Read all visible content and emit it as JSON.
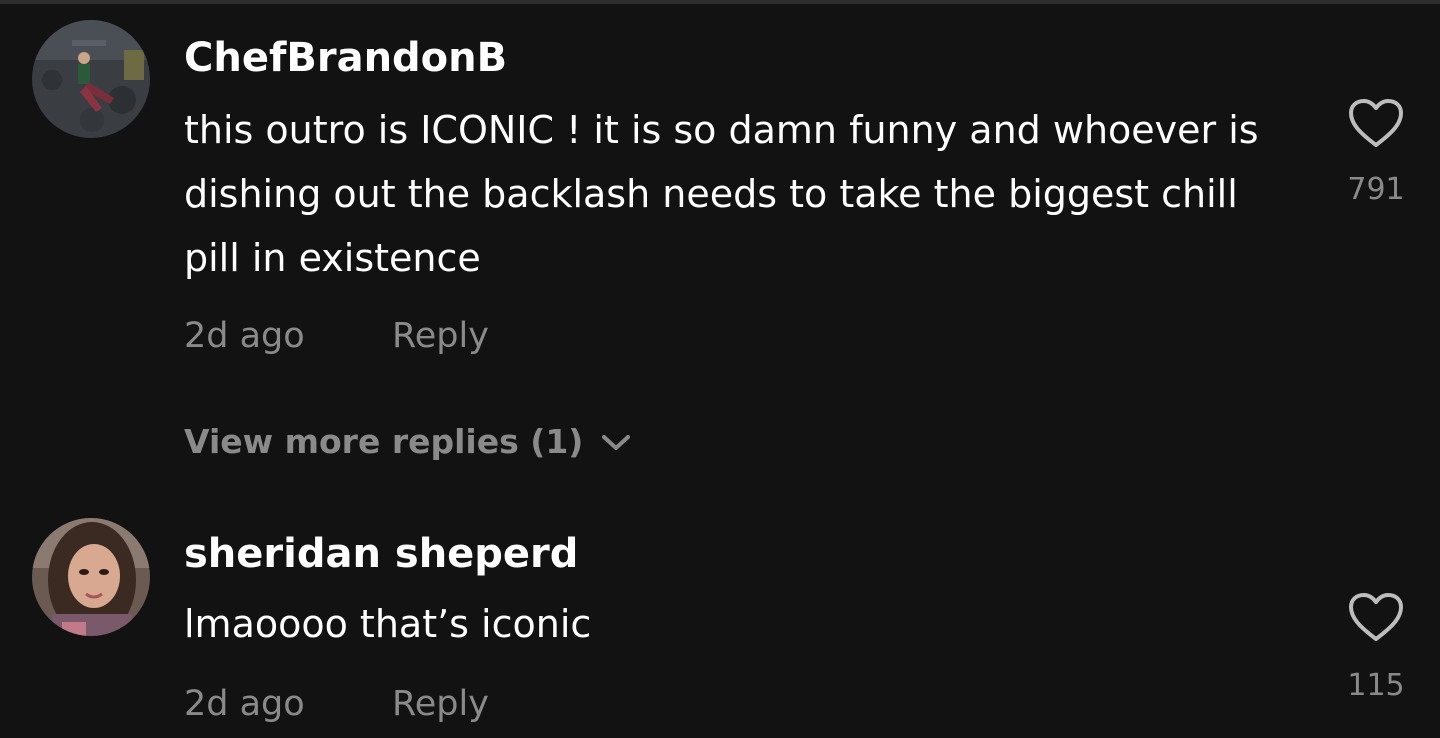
{
  "comments": [
    {
      "username": "ChefBrandonB",
      "text": "this outro is ICONIC ! it is so damn funny and whoever is dishing out the backlash needs to take the biggest chill pill in existence",
      "time": "2d ago",
      "reply_label": "Reply",
      "likes": "791",
      "view_more": "View more replies (1)"
    },
    {
      "username": "sheridan sheperd",
      "text": "lmaoooo that’s iconic",
      "time": "2d ago",
      "reply_label": "Reply",
      "likes": "115"
    }
  ],
  "icons": {
    "like": "heart-outline-icon",
    "expand": "chevron-down-icon"
  },
  "colors": {
    "background": "#121212",
    "primary_text": "#ffffff",
    "secondary_text": "#8a8a8a"
  }
}
